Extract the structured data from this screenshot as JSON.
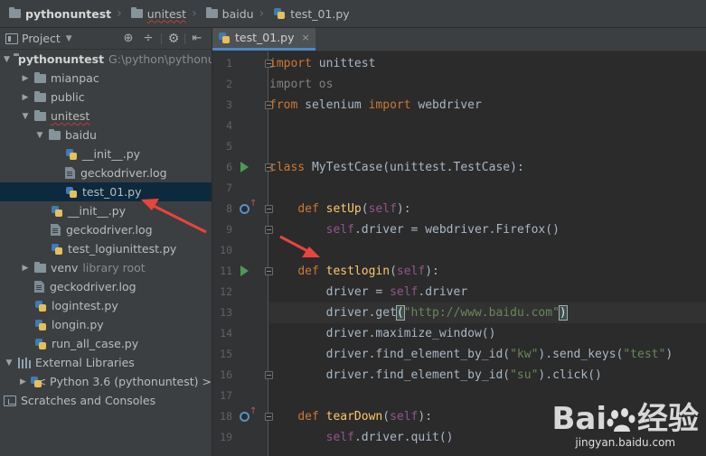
{
  "breadcrumb": [
    {
      "label": "pythonuntest",
      "icon": "folder-icon"
    },
    {
      "label": "unitest",
      "icon": "folder-icon"
    },
    {
      "label": "baidu",
      "icon": "folder-icon"
    },
    {
      "label": "test_01.py",
      "icon": "python-file-icon"
    }
  ],
  "project_panel": {
    "title": "Project",
    "dropdown": "▼",
    "tools": [
      "⊕",
      "÷",
      "⚙",
      "⇤"
    ]
  },
  "tree": [
    {
      "label": "pythonuntest",
      "hint": "G:\\python\\pythonuntest",
      "icon": "folder",
      "arrow": "▼",
      "indent": 4,
      "bold": true
    },
    {
      "label": "mianpac",
      "icon": "folder",
      "arrow": "▶",
      "indent": 22
    },
    {
      "label": "public",
      "icon": "folder",
      "arrow": "▶",
      "indent": 22
    },
    {
      "label": "unitest",
      "icon": "folder",
      "arrow": "▼",
      "indent": 22,
      "squiggle": true
    },
    {
      "label": "baidu",
      "icon": "folder",
      "arrow": "▼",
      "indent": 38
    },
    {
      "label": "__init__.py",
      "icon": "python",
      "indent": 72
    },
    {
      "label": "geckodriver.log",
      "icon": "file",
      "indent": 72
    },
    {
      "label": "test_01.py",
      "icon": "python",
      "indent": 72,
      "selected": true
    },
    {
      "label": "__init__.py",
      "icon": "python",
      "indent": 56
    },
    {
      "label": "geckodriver.log",
      "icon": "file",
      "indent": 56
    },
    {
      "label": "test_logiunittest.py",
      "icon": "python",
      "indent": 56
    },
    {
      "label": "venv",
      "hint": "library root",
      "icon": "folder",
      "arrow": "▶",
      "indent": 22
    },
    {
      "label": "geckodriver.log",
      "icon": "file",
      "indent": 38
    },
    {
      "label": "logintest.py",
      "icon": "python",
      "indent": 38
    },
    {
      "label": "longin.py",
      "icon": "python",
      "indent": 38
    },
    {
      "label": "run_all_case.py",
      "icon": "python",
      "indent": 38
    },
    {
      "label": "External Libraries",
      "icon": "library",
      "arrow": "▼",
      "indent": 4
    },
    {
      "label": "< Python 3.6 (pythonuntest) >",
      "icon": "python",
      "arrow": "▶",
      "indent": 22
    },
    {
      "label": "Scratches and Consoles",
      "icon": "scratch",
      "indent": 4
    }
  ],
  "editor": {
    "tab": {
      "label": "test_01.py",
      "close": "×"
    },
    "current_line": 13,
    "lines": [
      {
        "n": "1",
        "fold": true,
        "tokens": [
          [
            "kw",
            "import"
          ],
          [
            "pl",
            " unittest"
          ]
        ]
      },
      {
        "n": "2",
        "tokens": [
          [
            "gr",
            "import os"
          ]
        ]
      },
      {
        "n": "3",
        "fold": true,
        "tokens": [
          [
            "kw",
            "from"
          ],
          [
            "pl",
            " selenium "
          ],
          [
            "kw",
            "import"
          ],
          [
            "pl",
            " webdriver"
          ]
        ]
      },
      {
        "n": "4",
        "tokens": []
      },
      {
        "n": "5",
        "tokens": []
      },
      {
        "n": "6",
        "run": true,
        "fold": true,
        "tokens": [
          [
            "kw",
            "class"
          ],
          [
            "pl",
            " MyTestCase(unittest.TestCase):"
          ]
        ]
      },
      {
        "n": "7",
        "tokens": []
      },
      {
        "n": "8",
        "override": true,
        "fold": true,
        "tokens": [
          [
            "pl",
            "    "
          ],
          [
            "kw",
            "def"
          ],
          [
            "pl",
            " "
          ],
          [
            "fn",
            "setUp"
          ],
          [
            "pl",
            "("
          ],
          [
            "sf",
            "self"
          ],
          [
            "pl",
            "):"
          ]
        ]
      },
      {
        "n": "9",
        "fold": true,
        "tokens": [
          [
            "pl",
            "        "
          ],
          [
            "sf",
            "self"
          ],
          [
            "pl",
            ".driver = webdriver.Firefox()"
          ]
        ]
      },
      {
        "n": "10",
        "tokens": []
      },
      {
        "n": "11",
        "run": true,
        "fold": true,
        "tokens": [
          [
            "pl",
            "    "
          ],
          [
            "kw",
            "def"
          ],
          [
            "pl",
            " "
          ],
          [
            "fn",
            "testlogin"
          ],
          [
            "pl",
            "("
          ],
          [
            "sf",
            "self"
          ],
          [
            "pl",
            "):"
          ]
        ]
      },
      {
        "n": "12",
        "tokens": [
          [
            "pl",
            "        driver = "
          ],
          [
            "sf",
            "self"
          ],
          [
            "pl",
            ".driver"
          ]
        ]
      },
      {
        "n": "13",
        "tokens": [
          [
            "pl",
            "        driver.get"
          ],
          [
            "brk",
            "("
          ],
          [
            "st",
            "\"http://www.baidu.com\""
          ],
          [
            "brk",
            ")"
          ]
        ]
      },
      {
        "n": "14",
        "tokens": [
          [
            "pl",
            "        driver.maximize_window()"
          ]
        ]
      },
      {
        "n": "15",
        "tokens": [
          [
            "pl",
            "        driver.find_element_by_id("
          ],
          [
            "st",
            "\"kw\""
          ],
          [
            "pl",
            ").send_keys("
          ],
          [
            "st",
            "\"test\""
          ],
          [
            "pl",
            ")"
          ]
        ]
      },
      {
        "n": "16",
        "fold": true,
        "tokens": [
          [
            "pl",
            "        driver.find_element_by_id("
          ],
          [
            "st",
            "\"su\""
          ],
          [
            "pl",
            ").click()"
          ]
        ]
      },
      {
        "n": "17",
        "tokens": []
      },
      {
        "n": "18",
        "override": true,
        "fold": true,
        "tokens": [
          [
            "pl",
            "    "
          ],
          [
            "kw",
            "def"
          ],
          [
            "pl",
            " "
          ],
          [
            "fn",
            "tearDown"
          ],
          [
            "pl",
            "("
          ],
          [
            "sf",
            "self"
          ],
          [
            "pl",
            "):"
          ]
        ]
      },
      {
        "n": "19",
        "tokens": [
          [
            "pl",
            "        "
          ],
          [
            "sf",
            "self"
          ],
          [
            "pl",
            ".driver.quit()"
          ]
        ]
      }
    ]
  },
  "watermark": {
    "brand": "Bai",
    "brand2": "经验",
    "url": "jingyan.baidu.com"
  },
  "colors": {
    "accent": "#4a88c7",
    "selection": "#0d293e",
    "annotation_arrow": "#e8453c"
  }
}
